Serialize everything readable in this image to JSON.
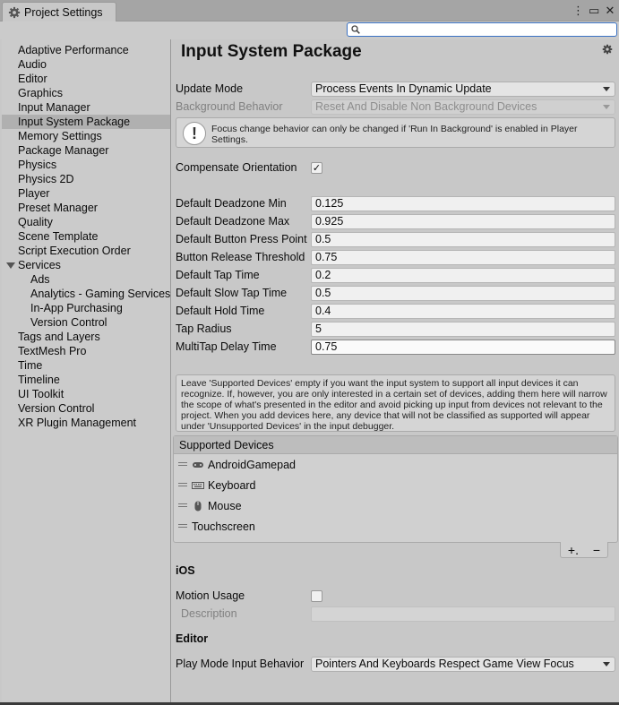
{
  "window": {
    "tab_title": "Project Settings",
    "menu_icon": "kebab-menu-icon",
    "maximize_icon": "maximize-icon",
    "close_icon": "close-icon"
  },
  "search": {
    "placeholder": "",
    "value": ""
  },
  "sidebar": {
    "items": [
      {
        "label": "Adaptive Performance"
      },
      {
        "label": "Audio"
      },
      {
        "label": "Editor"
      },
      {
        "label": "Graphics"
      },
      {
        "label": "Input Manager"
      },
      {
        "label": "Input System Package"
      },
      {
        "label": "Memory Settings"
      },
      {
        "label": "Package Manager"
      },
      {
        "label": "Physics"
      },
      {
        "label": "Physics 2D"
      },
      {
        "label": "Player"
      },
      {
        "label": "Preset Manager"
      },
      {
        "label": "Quality"
      },
      {
        "label": "Scene Template"
      },
      {
        "label": "Script Execution Order"
      },
      {
        "label": "Services"
      },
      {
        "label": "Ads"
      },
      {
        "label": "Analytics - Gaming Services"
      },
      {
        "label": "In-App Purchasing"
      },
      {
        "label": "Version Control"
      },
      {
        "label": "Tags and Layers"
      },
      {
        "label": "TextMesh Pro"
      },
      {
        "label": "Time"
      },
      {
        "label": "Timeline"
      },
      {
        "label": "UI Toolkit"
      },
      {
        "label": "Version Control"
      },
      {
        "label": "XR Plugin Management"
      }
    ],
    "selected": "Input System Package"
  },
  "main": {
    "title": "Input System Package",
    "update_mode": {
      "label": "Update Mode",
      "value": "Process Events In Dynamic Update"
    },
    "background_behavior": {
      "label": "Background Behavior",
      "value": "Reset And Disable Non Background Devices"
    },
    "focus_warning": "Focus change behavior can only be changed if 'Run In Background' is enabled in Player Settings.",
    "compensate_orientation": {
      "label": "Compensate Orientation",
      "checked": true,
      "mark": "✓"
    },
    "fields": [
      {
        "label": "Default Deadzone Min",
        "value": "0.125"
      },
      {
        "label": "Default Deadzone Max",
        "value": "0.925"
      },
      {
        "label": "Default Button Press Point",
        "value": "0.5"
      },
      {
        "label": "Button Release Threshold",
        "value": "0.75"
      },
      {
        "label": "Default Tap Time",
        "value": "0.2"
      },
      {
        "label": "Default Slow Tap Time",
        "value": "0.5"
      },
      {
        "label": "Default Hold Time",
        "value": "0.4"
      },
      {
        "label": "Tap Radius",
        "value": "5"
      },
      {
        "label": "MultiTap Delay Time",
        "value": "0.75"
      }
    ],
    "devices_info": "Leave 'Supported Devices' empty if you want the input system to support all input devices it can recognize. If, however, you are only interested in a certain set of devices, adding them here will narrow the scope of what's presented in the editor and avoid picking up input from devices not relevant to the project. When you add devices here, any device that will not be classified as supported will appear under 'Unsupported Devices' in the input debugger.",
    "supported_devices": {
      "header": "Supported Devices",
      "items": [
        {
          "label": "AndroidGamepad",
          "icon": "gamepad-icon"
        },
        {
          "label": "Keyboard",
          "icon": "keyboard-icon"
        },
        {
          "label": "Mouse",
          "icon": "mouse-icon"
        },
        {
          "label": "Touchscreen",
          "icon": ""
        }
      ],
      "add_label": "+.",
      "remove_label": "−"
    },
    "ios": {
      "header": "iOS",
      "motion_usage": {
        "label": "Motion Usage",
        "checked": false
      },
      "description": {
        "label": "Description",
        "value": ""
      }
    },
    "editor": {
      "header": "Editor",
      "play_mode": {
        "label": "Play Mode Input Behavior",
        "value": "Pointers And Keyboards Respect Game View Focus"
      }
    }
  }
}
